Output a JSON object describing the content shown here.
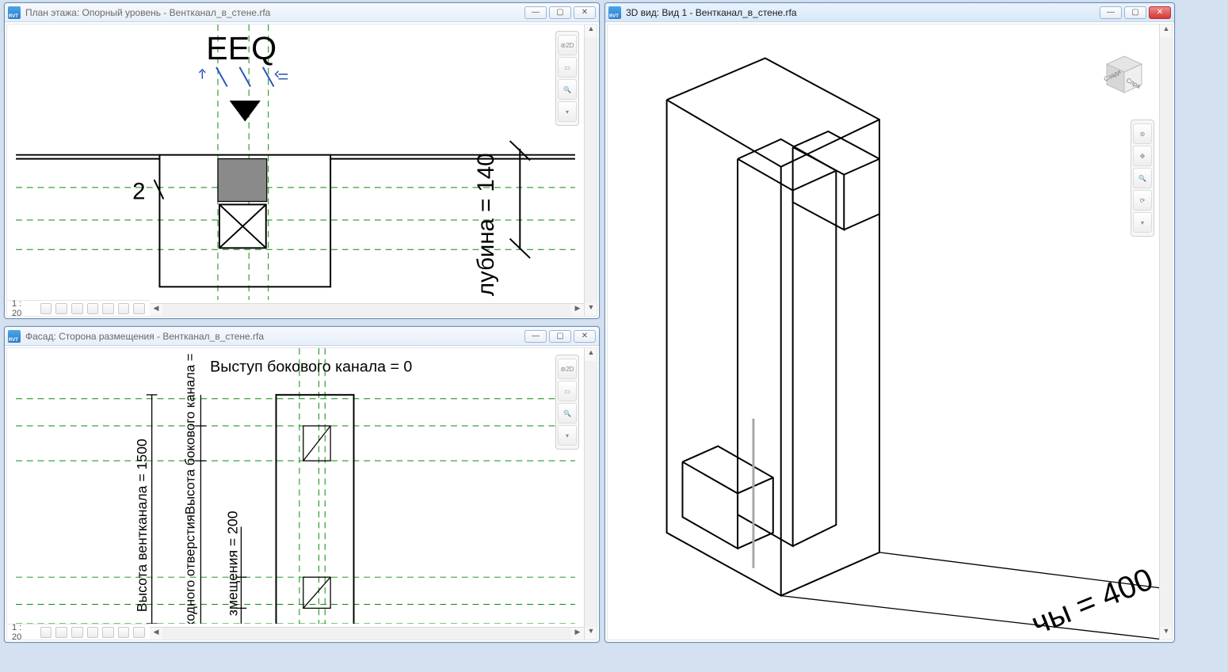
{
  "windows": {
    "plan": {
      "title": "План этажа: Опорный уровень - Вентканал_в_стене.rfa",
      "scale": "1 : 20",
      "eq1": "EQ",
      "eq2": "EQ",
      "dim_depth": "лубина = 140",
      "dim_tick": "2"
    },
    "facade": {
      "title": "Фасад: Сторона размещения - Вентканал_в_стене.rfa",
      "scale": "1 : 20",
      "label_side_protrusion": "Выступ бокового канала = 0",
      "label_height": "Высота вентканала = 1500",
      "label_side_height": "ходного отверстияВысота бокового канала =",
      "label_offset": "змещения = 200"
    },
    "threeD": {
      "title": "3D вид: Вид 1 - Вентканал_в_стене.rfa",
      "dim_width": "чы = 400",
      "cube_left": "Сзади",
      "cube_right": "Спра"
    }
  },
  "icons": {
    "min": "—",
    "max": "▢",
    "close": "✕",
    "arrow_up": "▲",
    "arrow_down": "▼",
    "arrow_left": "◀",
    "arrow_right": "▶",
    "wheel": "⌘"
  }
}
